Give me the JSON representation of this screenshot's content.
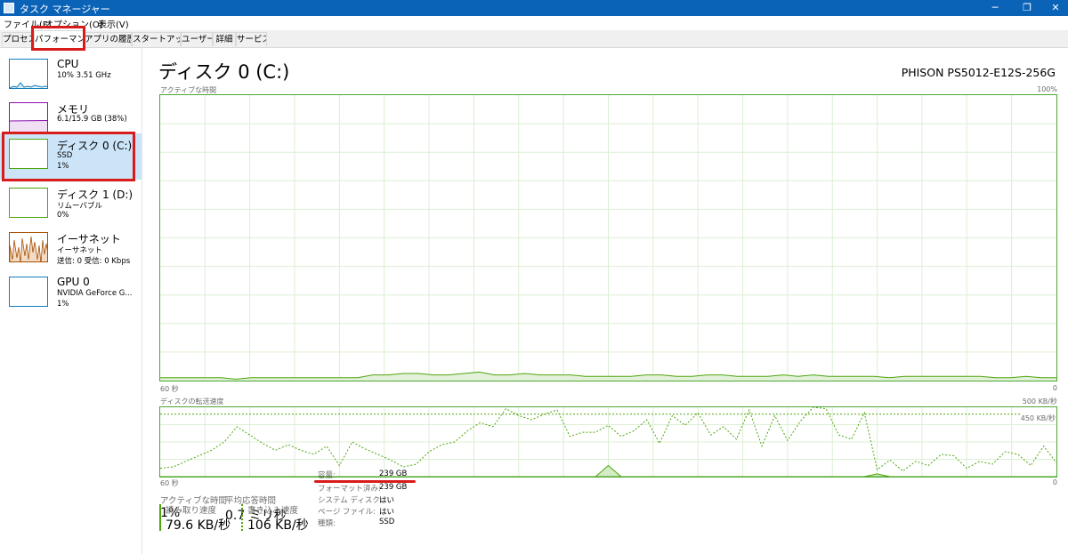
{
  "window": {
    "title": "タスク マネージャー",
    "controls": [
      "─",
      "❐",
      "✕"
    ]
  },
  "menu": {
    "file": "ファイル(F)",
    "options": "オプション(O)",
    "view": "表示(V)"
  },
  "tabs": [
    "プロセス",
    "パフォーマンス",
    "アプリの履歴",
    "スタートアップ",
    "ユーザー",
    "詳細",
    "サービス"
  ],
  "active_tab": "パフォーマンス",
  "sidebar": {
    "items": [
      {
        "name": "CPU",
        "sub": "10%  3.51 GHz",
        "sub2": "",
        "color": "#117dbb"
      },
      {
        "name": "メモリ",
        "sub": "6.1/15.9 GB (38%)",
        "sub2": "",
        "color": "#8b12ae"
      },
      {
        "name": "ディスク 0 (C:)",
        "sub": "SSD",
        "sub2": "1%",
        "color": "#4da60c"
      },
      {
        "name": "ディスク 1 (D:)",
        "sub": "リムーバブル",
        "sub2": "0%",
        "color": "#4da60c"
      },
      {
        "name": "イーサネット",
        "sub": "イーサネット",
        "sub2": "送信: 0  受信: 0 Kbps",
        "color": "#a74f01"
      },
      {
        "name": "GPU 0",
        "sub": "NVIDIA GeForce G...",
        "sub2": "1%",
        "color": "#117dbb"
      }
    ],
    "selected": "ディスク 0 (C:)"
  },
  "main": {
    "title": "ディスク 0 (C:)",
    "device": "PHISON PS5012-E12S-256G",
    "active_time_graph": {
      "label": "アクティブな時間",
      "max_label": "100%",
      "time_label": "60 秒",
      "zero_label": "0",
      "values": [
        1,
        1,
        1,
        1,
        1,
        0.5,
        1,
        1,
        1,
        1,
        1,
        1,
        1,
        1,
        2,
        2,
        2.5,
        2.5,
        2,
        2,
        2.5,
        3,
        2,
        2,
        2.5,
        2,
        2,
        2,
        1.5,
        1.5,
        1.5,
        1.5,
        2,
        2,
        1.5,
        1.5,
        2,
        2,
        1.5,
        1.5,
        1.5,
        2,
        1.5,
        2,
        1.5,
        1.5,
        1.5,
        1.5,
        1,
        1.5,
        1.5,
        1.5,
        1.5,
        1.5,
        1.5,
        1,
        1,
        1.5,
        1,
        1
      ]
    },
    "transfer_graph": {
      "label": "ディスクの転送速度",
      "max_label": "500 KB/秒",
      "ref_label": "450 KB/秒",
      "time_label": "60 秒",
      "zero_label": "0",
      "read_values": [
        0,
        0,
        0,
        0,
        0,
        0,
        0,
        0,
        0,
        0,
        0,
        0,
        0,
        0,
        0,
        0,
        0,
        0,
        0,
        0,
        0,
        0,
        0,
        0,
        0,
        0,
        0,
        0,
        0,
        0,
        0,
        0,
        0,
        0,
        0,
        80,
        0,
        0,
        0,
        0,
        0,
        0,
        0,
        0,
        0,
        0,
        0,
        0,
        0,
        0,
        0,
        0,
        0,
        0,
        0,
        0,
        20,
        0,
        0,
        0,
        0,
        0,
        0,
        0,
        0,
        0,
        0,
        0,
        0,
        0,
        0
      ],
      "write_values": [
        60,
        70,
        110,
        150,
        190,
        250,
        360,
        300,
        240,
        190,
        230,
        190,
        160,
        220,
        80,
        250,
        200,
        160,
        120,
        70,
        90,
        180,
        230,
        250,
        330,
        390,
        360,
        490,
        440,
        410,
        450,
        480,
        290,
        320,
        320,
        370,
        290,
        330,
        410,
        240,
        440,
        370,
        460,
        300,
        360,
        270,
        480,
        220,
        440,
        260,
        400,
        500,
        490,
        300,
        270,
        460,
        50,
        120,
        40,
        110,
        80,
        160,
        150,
        60,
        110,
        90,
        180,
        160,
        80,
        220,
        100
      ]
    },
    "stats": {
      "active_time": {
        "label": "アクティブな時間",
        "value": "1%"
      },
      "response_time": {
        "label": "平均応答時間",
        "value": "0.7 ミリ秒"
      },
      "read_speed": {
        "label": "読み取り速度",
        "value": "79.6 KB/秒"
      },
      "write_speed": {
        "label": "書き込み速度",
        "value": "106 KB/秒"
      }
    },
    "info": [
      {
        "label": "容量:",
        "value": "239 GB"
      },
      {
        "label": "フォーマット済み:",
        "value": "239 GB"
      },
      {
        "label": "システム ディスク:",
        "value": "はい"
      },
      {
        "label": "ページ ファイル:",
        "value": "はい"
      },
      {
        "label": "種類:",
        "value": "SSD"
      }
    ]
  },
  "colors": {
    "titlebar": "#0b63b8",
    "disk_green": "#4da60c",
    "highlight": "#d81b1b",
    "selected_bg": "#cce4f7"
  }
}
